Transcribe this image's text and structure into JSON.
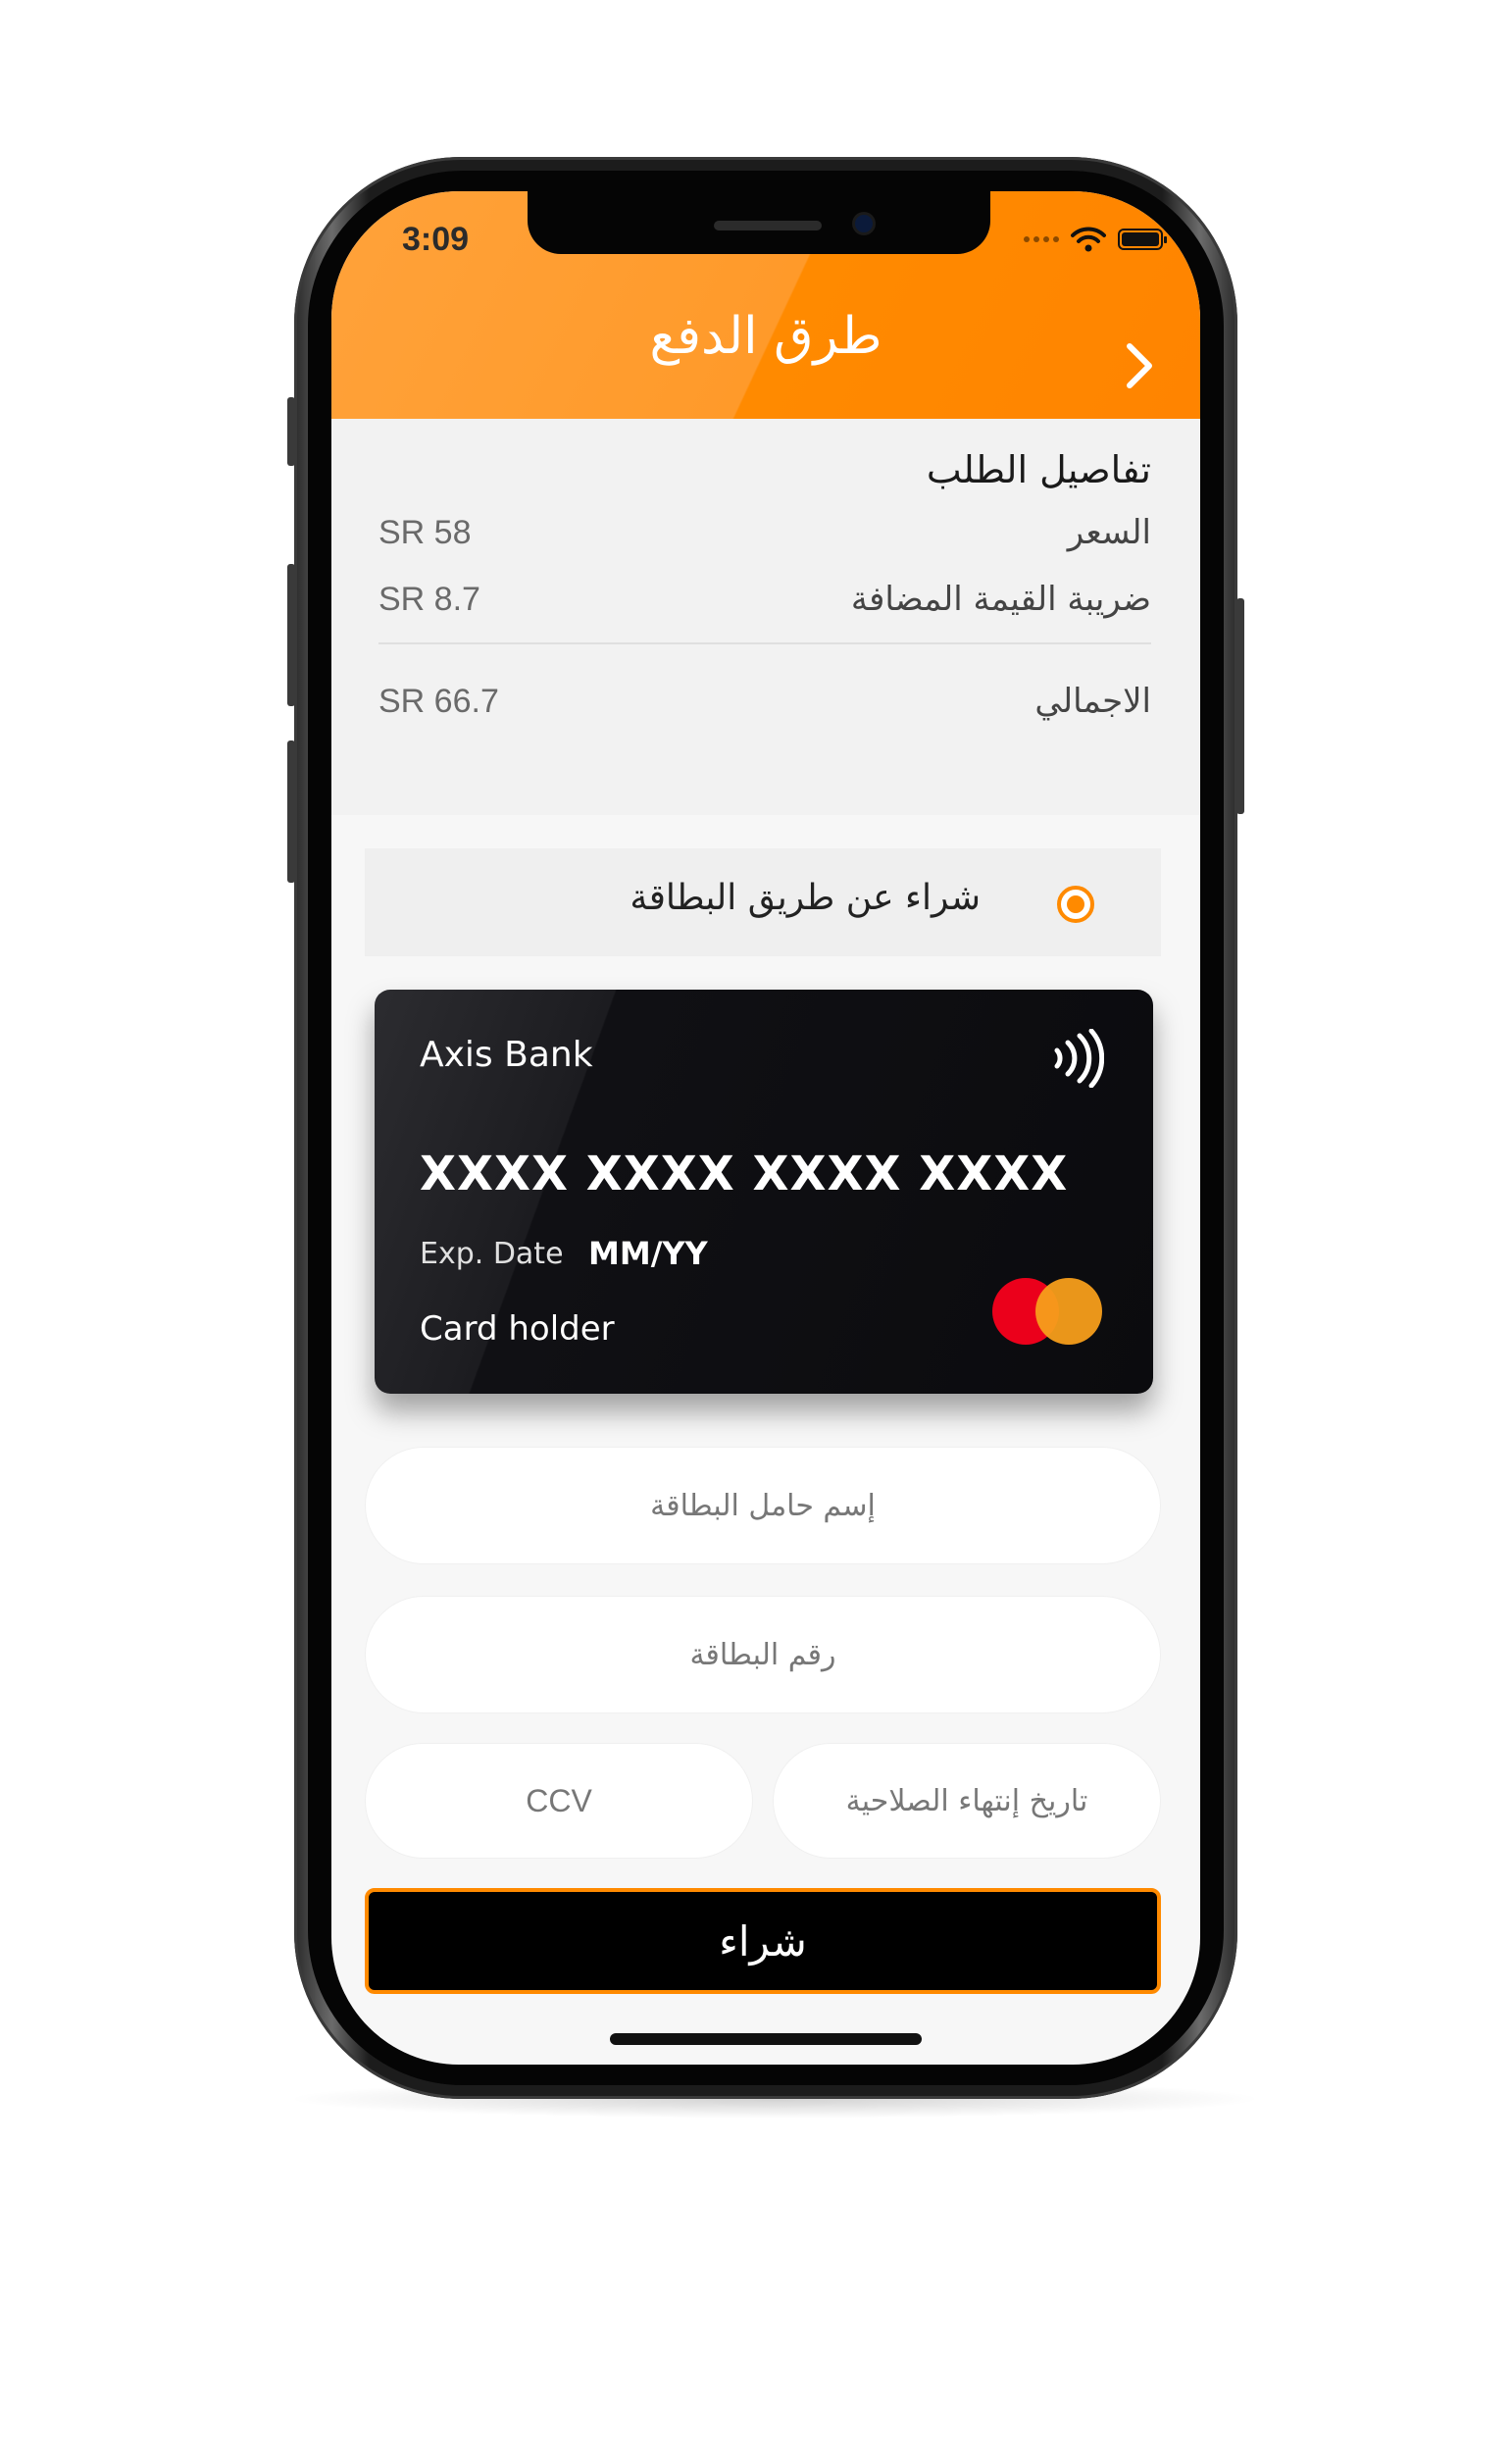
{
  "status_bar": {
    "time": "3:09"
  },
  "header": {
    "title": "طرق الدفع",
    "back_icon": "chevron-right-icon"
  },
  "order_details": {
    "title": "تفاصيل الطلب",
    "rows": [
      {
        "label": "السعر",
        "amount": "SR 58"
      },
      {
        "label": "ضريبة القيمة المضافة",
        "amount": "SR 8.7"
      }
    ],
    "total": {
      "label": "الاجمالي",
      "amount": "SR 66.7"
    }
  },
  "payment_option": {
    "label": "شراء عن طريق البطاقة",
    "selected": true
  },
  "card": {
    "bank": "Axis Bank",
    "number": "XXXX XXXX XXXX XXXX",
    "exp_label": "Exp. Date",
    "exp_value": "MM/YY",
    "holder": "Card holder",
    "brand_icon": "mastercard-icon",
    "contactless_icon": "contactless-icon"
  },
  "form": {
    "holder_name_placeholder": "إسم حامل البطاقة",
    "card_number_placeholder": "رقم البطاقة",
    "ccv_placeholder": "CCV",
    "expiry_placeholder": "تاريخ إنتهاء الصلاحية"
  },
  "buy_button": {
    "label": "شراء"
  },
  "colors": {
    "accent": "#ff8a00",
    "card_bg": "#0b0b0e"
  }
}
